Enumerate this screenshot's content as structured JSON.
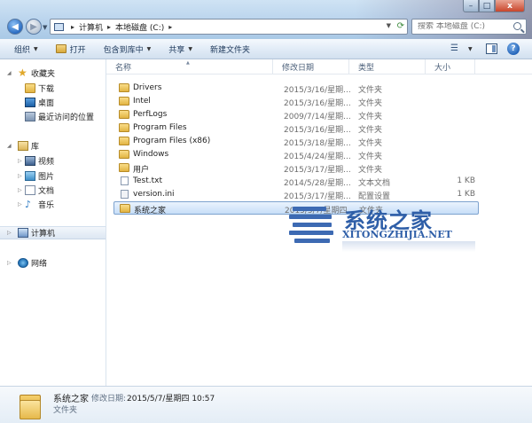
{
  "window": {
    "controls": {
      "minimize": "–",
      "maximize": "□",
      "close": "x"
    }
  },
  "address": {
    "crumbs": [
      "计算机",
      "本地磁盘 (C:)"
    ],
    "separator": "▸"
  },
  "search": {
    "placeholder": "搜索 本地磁盘 (C:)"
  },
  "toolbar": {
    "organize": "组织",
    "open": "打开",
    "include_library": "包含到库中",
    "share": "共享",
    "new_folder": "新建文件夹",
    "help": "?"
  },
  "navpane": {
    "favorites": {
      "label": "收藏夹",
      "items": [
        "下载",
        "桌面",
        "最近访问的位置"
      ]
    },
    "libraries": {
      "label": "库",
      "items": [
        "视频",
        "图片",
        "文档",
        "音乐"
      ]
    },
    "computer": "计算机",
    "network": "网络"
  },
  "columns": {
    "name": "名称",
    "date": "修改日期",
    "type": "类型",
    "size": "大小"
  },
  "files": [
    {
      "name": "Drivers",
      "date": "2015/3/16/星期...",
      "type": "文件夹",
      "size": "",
      "icon": "folder-icon"
    },
    {
      "name": "Intel",
      "date": "2015/3/16/星期...",
      "type": "文件夹",
      "size": "",
      "icon": "folder-icon"
    },
    {
      "name": "PerfLogs",
      "date": "2009/7/14/星期...",
      "type": "文件夹",
      "size": "",
      "icon": "folder-icon"
    },
    {
      "name": "Program Files",
      "date": "2015/3/16/星期...",
      "type": "文件夹",
      "size": "",
      "icon": "folder-icon"
    },
    {
      "name": "Program Files (x86)",
      "date": "2015/3/18/星期...",
      "type": "文件夹",
      "size": "",
      "icon": "folder-icon"
    },
    {
      "name": "Windows",
      "date": "2015/4/24/星期...",
      "type": "文件夹",
      "size": "",
      "icon": "folder-icon"
    },
    {
      "name": "用户",
      "date": "2015/3/17/星期...",
      "type": "文件夹",
      "size": "",
      "icon": "folder-icon"
    },
    {
      "name": "Test.txt",
      "date": "2014/5/28/星期...",
      "type": "文本文档",
      "size": "1 KB",
      "icon": "text-file-icon"
    },
    {
      "name": "version.ini",
      "date": "2015/3/17/星期...",
      "type": "配置设置",
      "size": "1 KB",
      "icon": "config-file-icon"
    },
    {
      "name": "系统之家",
      "date": "2015/5/7/星期四",
      "type": "文件夹",
      "size": "",
      "icon": "folder-icon"
    }
  ],
  "selected_index": 9,
  "watermark": {
    "cn": "系统之家",
    "en": "XITONGZHIJIA.NET"
  },
  "details": {
    "name": "系统之家",
    "date_label": "修改日期:",
    "date": "2015/5/7/星期四 10:57",
    "type": "文件夹"
  },
  "colors": {
    "accent": "#2f5fa8",
    "selection": "#c7def8",
    "folder": "#e2b443"
  }
}
